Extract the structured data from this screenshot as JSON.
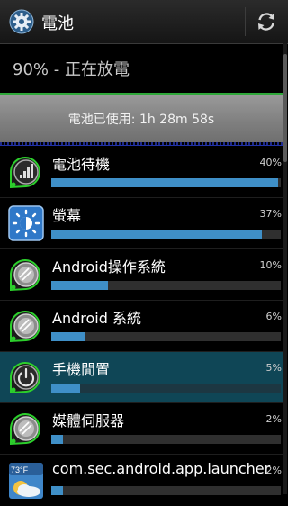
{
  "header": {
    "title": "電池",
    "settings_icon": "gear-icon",
    "refresh_icon": "refresh-icon"
  },
  "summary": {
    "status": "90% - 正在放電"
  },
  "graph": {
    "label": "電池已使用: 1h 28m 58s",
    "line_color": "#2fa83a"
  },
  "usage": [
    {
      "name": "電池待機",
      "percent_label": "40%",
      "fraction": 0.4,
      "icon": "signal-icon"
    },
    {
      "name": "螢幕",
      "percent_label": "37%",
      "fraction": 0.37,
      "icon": "brightness-icon"
    },
    {
      "name": "Android操作系統",
      "percent_label": "10%",
      "fraction": 0.1,
      "icon": "android-icon"
    },
    {
      "name": "Android 系統",
      "percent_label": "6%",
      "fraction": 0.06,
      "icon": "android-icon"
    },
    {
      "name": "手機閒置",
      "percent_label": "5%",
      "fraction": 0.05,
      "icon": "power-icon"
    },
    {
      "name": "媒體伺服器",
      "percent_label": "2%",
      "fraction": 0.02,
      "icon": "android-icon"
    },
    {
      "name": "com.sec.android.app.launcher",
      "percent_label": "2%",
      "fraction": 0.02,
      "icon": "launcher-icon"
    }
  ],
  "launcher_icon_text": "73°F",
  "colors": {
    "bar": "#3f8fc7",
    "active_row": "#0f4656"
  }
}
